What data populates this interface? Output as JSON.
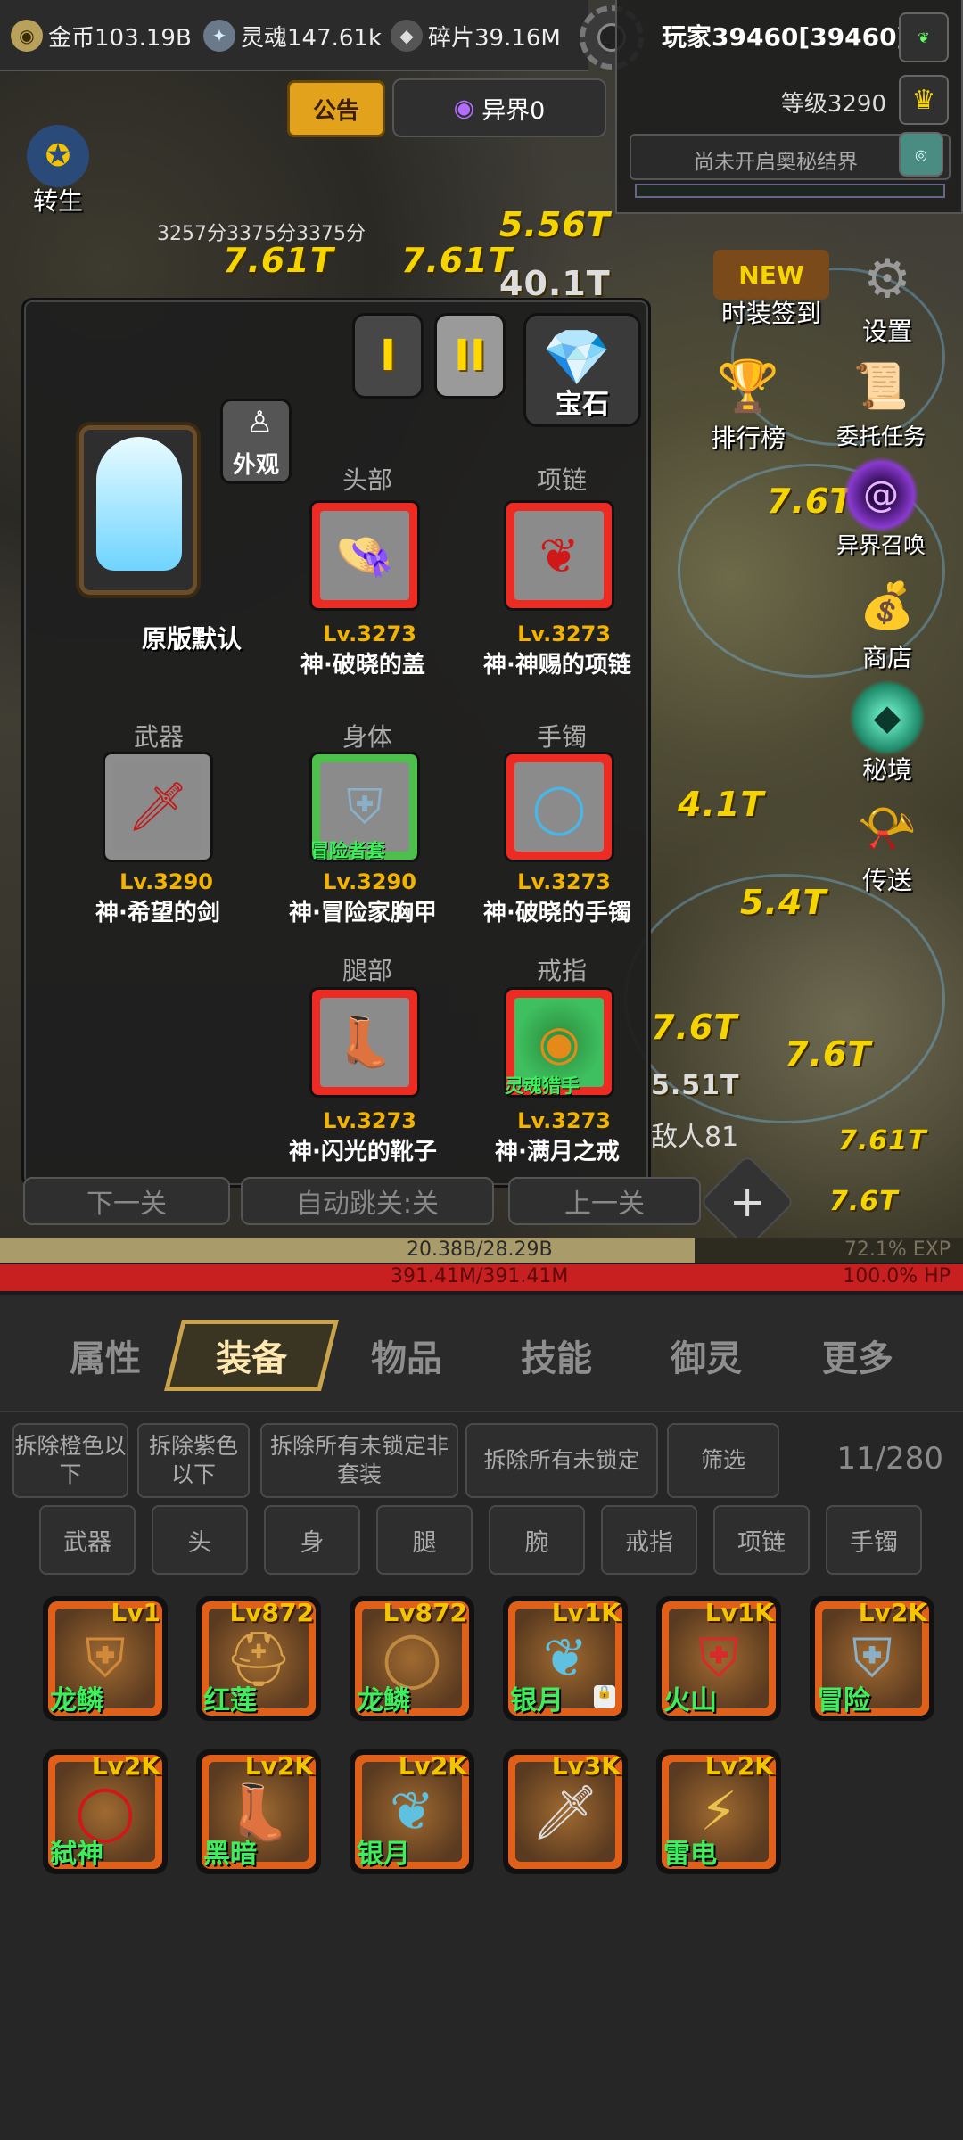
{
  "resources": {
    "gold": "金币103.19B",
    "soul": "灵魂147.61k",
    "shards": "碎片39.16M"
  },
  "player": {
    "name": "玩家39460[39460]",
    "level": "等级3290",
    "realm_status": "尚未开启奥秘结界"
  },
  "top_buttons": {
    "notice": "公告",
    "otherworld": "异界0",
    "rebirth": "转生",
    "score_text": "3257分3375分3375分"
  },
  "side_menu": [
    {
      "label": "时装签到",
      "icon": "new-badge-icon"
    },
    {
      "label": "设置",
      "icon": "gear-icon"
    },
    {
      "label": "排行榜",
      "icon": "trophy-icon"
    },
    {
      "label": "委托任务",
      "icon": "scroll-icon"
    },
    {
      "label": "异界召唤",
      "icon": "portal-icon"
    },
    {
      "label": "商店",
      "icon": "shop-icon"
    },
    {
      "label": "秘境",
      "icon": "crystal-icon"
    },
    {
      "label": "传送",
      "icon": "horn-icon"
    }
  ],
  "battle_text": {
    "enemy_count": "敌人81",
    "damage_a": "5.51T",
    "damage_b": "7.61T",
    "damage_c": "40.1T"
  },
  "equip_panel": {
    "page_1": "I",
    "page_2": "II",
    "gem_label": "宝石",
    "appearance_label": "外观",
    "skin_name": "原版默认",
    "slots": [
      {
        "slot": "头部",
        "level": "Lv.3273",
        "name": "神·破晓的盖",
        "icon": "hat-icon",
        "set": ""
      },
      {
        "slot": "项链",
        "level": "Lv.3273",
        "name": "神·神赐的项链",
        "icon": "necklace-icon",
        "set": ""
      },
      {
        "slot": "武器",
        "level": "Lv.3290",
        "name": "神·希望的剑",
        "icon": "sword-icon",
        "set": ""
      },
      {
        "slot": "身体",
        "level": "Lv.3290",
        "name": "神·冒险家胸甲",
        "icon": "armor-icon",
        "set": "冒险者套"
      },
      {
        "slot": "手镯",
        "level": "Lv.3273",
        "name": "神·破晓的手镯",
        "icon": "bracelet-icon",
        "set": ""
      },
      {
        "slot": "腿部",
        "level": "Lv.3273",
        "name": "神·闪光的靴子",
        "icon": "boot-icon",
        "set": ""
      },
      {
        "slot": "戒指",
        "level": "Lv.3273",
        "name": "神·满月之戒",
        "icon": "ring-icon",
        "set": "灵魂猎手"
      }
    ]
  },
  "stage_nav": {
    "next": "下一关",
    "auto": "自动跳关:关",
    "prev": "上一关"
  },
  "bars": {
    "exp_value": "20.38B/28.29B",
    "exp_percent": "72.1% EXP",
    "exp_fraction": 0.721,
    "hp_value": "391.41M/391.41M",
    "hp_percent": "100.0% HP",
    "hp_fraction": 1.0
  },
  "main_tabs": [
    "属性",
    "装备",
    "物品",
    "技能",
    "御灵",
    "更多"
  ],
  "inventory": {
    "actions": [
      "拆除橙色以下",
      "拆除紫色以下",
      "拆除所有未锁定非套装",
      "拆除所有未锁定",
      "筛选"
    ],
    "count": "11/280",
    "filters": [
      "武器",
      "头",
      "身",
      "腿",
      "腕",
      "戒指",
      "项链",
      "手镯"
    ],
    "items": [
      {
        "level": "Lv1",
        "name": "龙鳞",
        "icon": "armor-icon",
        "locked": false
      },
      {
        "level": "Lv872",
        "name": "红莲",
        "icon": "helmet-icon",
        "locked": false
      },
      {
        "level": "Lv872",
        "name": "龙鳞",
        "icon": "bracelet-icon",
        "locked": false
      },
      {
        "level": "Lv1K",
        "name": "银月",
        "icon": "necklace-icon",
        "locked": true
      },
      {
        "level": "Lv1K",
        "name": "火山",
        "icon": "armor-icon",
        "locked": false
      },
      {
        "level": "Lv2K",
        "name": "冒险",
        "icon": "armor-icon",
        "locked": false
      },
      {
        "level": "Lv2K",
        "name": "弑神",
        "icon": "ring-icon",
        "locked": false
      },
      {
        "level": "Lv2K",
        "name": "黑暗",
        "icon": "boot-icon",
        "locked": false
      },
      {
        "level": "Lv2K",
        "name": "银月",
        "icon": "necklace-icon",
        "locked": false
      },
      {
        "level": "Lv3K",
        "name": "",
        "icon": "sword-icon",
        "locked": false
      },
      {
        "level": "Lv2K",
        "name": "雷电",
        "icon": "bracer-icon",
        "locked": false
      }
    ]
  }
}
